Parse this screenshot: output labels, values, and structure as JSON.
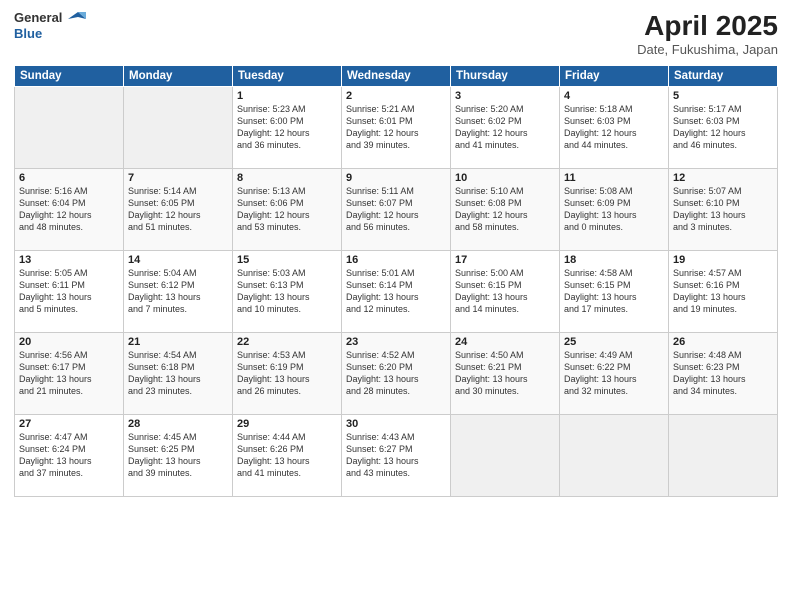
{
  "header": {
    "logo_general": "General",
    "logo_blue": "Blue",
    "title": "April 2025",
    "subtitle": "Date, Fukushima, Japan"
  },
  "weekdays": [
    "Sunday",
    "Monday",
    "Tuesday",
    "Wednesday",
    "Thursday",
    "Friday",
    "Saturday"
  ],
  "weeks": [
    [
      {
        "day": "",
        "info": ""
      },
      {
        "day": "",
        "info": ""
      },
      {
        "day": "1",
        "info": "Sunrise: 5:23 AM\nSunset: 6:00 PM\nDaylight: 12 hours\nand 36 minutes."
      },
      {
        "day": "2",
        "info": "Sunrise: 5:21 AM\nSunset: 6:01 PM\nDaylight: 12 hours\nand 39 minutes."
      },
      {
        "day": "3",
        "info": "Sunrise: 5:20 AM\nSunset: 6:02 PM\nDaylight: 12 hours\nand 41 minutes."
      },
      {
        "day": "4",
        "info": "Sunrise: 5:18 AM\nSunset: 6:03 PM\nDaylight: 12 hours\nand 44 minutes."
      },
      {
        "day": "5",
        "info": "Sunrise: 5:17 AM\nSunset: 6:03 PM\nDaylight: 12 hours\nand 46 minutes."
      }
    ],
    [
      {
        "day": "6",
        "info": "Sunrise: 5:16 AM\nSunset: 6:04 PM\nDaylight: 12 hours\nand 48 minutes."
      },
      {
        "day": "7",
        "info": "Sunrise: 5:14 AM\nSunset: 6:05 PM\nDaylight: 12 hours\nand 51 minutes."
      },
      {
        "day": "8",
        "info": "Sunrise: 5:13 AM\nSunset: 6:06 PM\nDaylight: 12 hours\nand 53 minutes."
      },
      {
        "day": "9",
        "info": "Sunrise: 5:11 AM\nSunset: 6:07 PM\nDaylight: 12 hours\nand 56 minutes."
      },
      {
        "day": "10",
        "info": "Sunrise: 5:10 AM\nSunset: 6:08 PM\nDaylight: 12 hours\nand 58 minutes."
      },
      {
        "day": "11",
        "info": "Sunrise: 5:08 AM\nSunset: 6:09 PM\nDaylight: 13 hours\nand 0 minutes."
      },
      {
        "day": "12",
        "info": "Sunrise: 5:07 AM\nSunset: 6:10 PM\nDaylight: 13 hours\nand 3 minutes."
      }
    ],
    [
      {
        "day": "13",
        "info": "Sunrise: 5:05 AM\nSunset: 6:11 PM\nDaylight: 13 hours\nand 5 minutes."
      },
      {
        "day": "14",
        "info": "Sunrise: 5:04 AM\nSunset: 6:12 PM\nDaylight: 13 hours\nand 7 minutes."
      },
      {
        "day": "15",
        "info": "Sunrise: 5:03 AM\nSunset: 6:13 PM\nDaylight: 13 hours\nand 10 minutes."
      },
      {
        "day": "16",
        "info": "Sunrise: 5:01 AM\nSunset: 6:14 PM\nDaylight: 13 hours\nand 12 minutes."
      },
      {
        "day": "17",
        "info": "Sunrise: 5:00 AM\nSunset: 6:15 PM\nDaylight: 13 hours\nand 14 minutes."
      },
      {
        "day": "18",
        "info": "Sunrise: 4:58 AM\nSunset: 6:15 PM\nDaylight: 13 hours\nand 17 minutes."
      },
      {
        "day": "19",
        "info": "Sunrise: 4:57 AM\nSunset: 6:16 PM\nDaylight: 13 hours\nand 19 minutes."
      }
    ],
    [
      {
        "day": "20",
        "info": "Sunrise: 4:56 AM\nSunset: 6:17 PM\nDaylight: 13 hours\nand 21 minutes."
      },
      {
        "day": "21",
        "info": "Sunrise: 4:54 AM\nSunset: 6:18 PM\nDaylight: 13 hours\nand 23 minutes."
      },
      {
        "day": "22",
        "info": "Sunrise: 4:53 AM\nSunset: 6:19 PM\nDaylight: 13 hours\nand 26 minutes."
      },
      {
        "day": "23",
        "info": "Sunrise: 4:52 AM\nSunset: 6:20 PM\nDaylight: 13 hours\nand 28 minutes."
      },
      {
        "day": "24",
        "info": "Sunrise: 4:50 AM\nSunset: 6:21 PM\nDaylight: 13 hours\nand 30 minutes."
      },
      {
        "day": "25",
        "info": "Sunrise: 4:49 AM\nSunset: 6:22 PM\nDaylight: 13 hours\nand 32 minutes."
      },
      {
        "day": "26",
        "info": "Sunrise: 4:48 AM\nSunset: 6:23 PM\nDaylight: 13 hours\nand 34 minutes."
      }
    ],
    [
      {
        "day": "27",
        "info": "Sunrise: 4:47 AM\nSunset: 6:24 PM\nDaylight: 13 hours\nand 37 minutes."
      },
      {
        "day": "28",
        "info": "Sunrise: 4:45 AM\nSunset: 6:25 PM\nDaylight: 13 hours\nand 39 minutes."
      },
      {
        "day": "29",
        "info": "Sunrise: 4:44 AM\nSunset: 6:26 PM\nDaylight: 13 hours\nand 41 minutes."
      },
      {
        "day": "30",
        "info": "Sunrise: 4:43 AM\nSunset: 6:27 PM\nDaylight: 13 hours\nand 43 minutes."
      },
      {
        "day": "",
        "info": ""
      },
      {
        "day": "",
        "info": ""
      },
      {
        "day": "",
        "info": ""
      }
    ]
  ]
}
